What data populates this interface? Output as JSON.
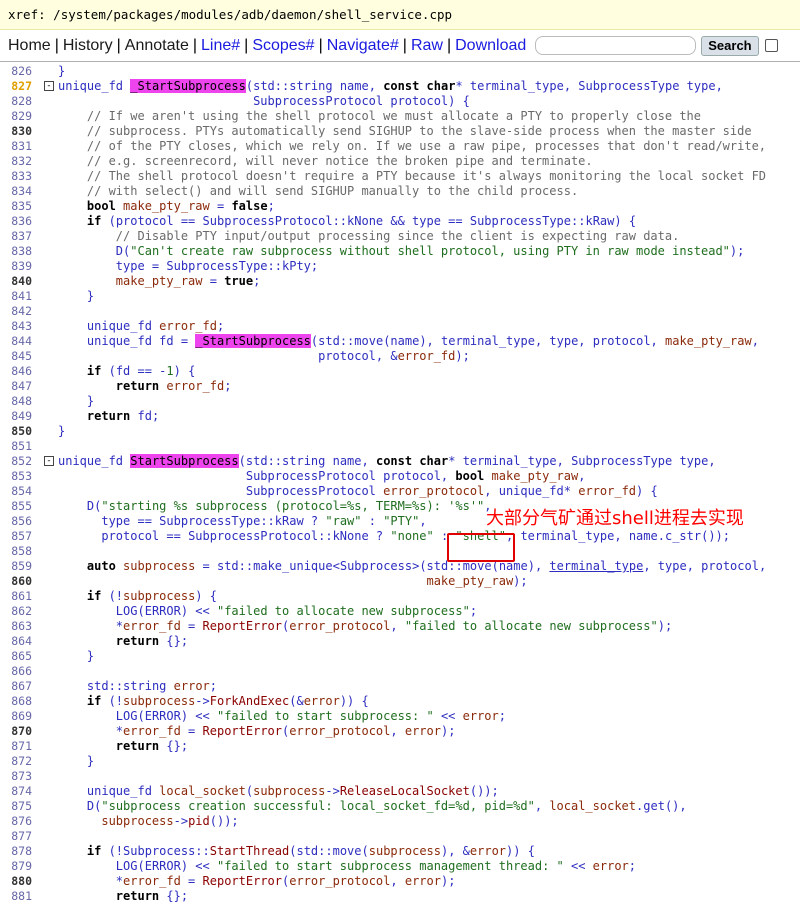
{
  "xref": {
    "label": "xref:",
    "path": "/system/packages/modules/adb/daemon/shell_service.cpp"
  },
  "nav": {
    "items": [
      {
        "label": "Home",
        "strong": true
      },
      {
        "label": "History",
        "strong": true
      },
      {
        "label": "Annotate",
        "strong": true
      },
      {
        "label": "Line#",
        "strong": false
      },
      {
        "label": "Scopes#",
        "strong": false
      },
      {
        "label": "Navigate#",
        "strong": false
      },
      {
        "label": "Raw",
        "strong": false
      },
      {
        "label": "Download",
        "strong": false
      }
    ],
    "search_value": "",
    "search_button": "Search"
  },
  "annotation": {
    "text": "大部分气矿通过shell进程去实现",
    "color": "#ff0000"
  },
  "lines": [
    {
      "n": "826",
      "t": "}"
    },
    {
      "n": "827",
      "t": "unique_fd _StartSubprocess(std::string name, const char* terminal_type, SubprocessType type,",
      "fold": true
    },
    {
      "n": "828",
      "t": "                           SubprocessProtocol protocol) {"
    },
    {
      "n": "829",
      "t": "    // If we aren't using the shell protocol we must allocate a PTY to properly close the"
    },
    {
      "n": "830",
      "t": "    // subprocess. PTYs automatically send SIGHUP to the slave-side process when the master side"
    },
    {
      "n": "831",
      "t": "    // of the PTY closes, which we rely on. If we use a raw pipe, processes that don't read/write,"
    },
    {
      "n": "832",
      "t": "    // e.g. screenrecord, will never notice the broken pipe and terminate."
    },
    {
      "n": "833",
      "t": "    // The shell protocol doesn't require a PTY because it's always monitoring the local socket FD"
    },
    {
      "n": "834",
      "t": "    // with select() and will send SIGHUP manually to the child process."
    },
    {
      "n": "835",
      "t": "    bool make_pty_raw = false;"
    },
    {
      "n": "836",
      "t": "    if (protocol == SubprocessProtocol::kNone && type == SubprocessType::kRaw) {"
    },
    {
      "n": "837",
      "t": "        // Disable PTY input/output processing since the client is expecting raw data."
    },
    {
      "n": "838",
      "t": "        D(\"Can't create raw subprocess without shell protocol, using PTY in raw mode instead\");"
    },
    {
      "n": "839",
      "t": "        type = SubprocessType::kPty;"
    },
    {
      "n": "840",
      "t": "        make_pty_raw = true;"
    },
    {
      "n": "841",
      "t": "    }"
    },
    {
      "n": "842",
      "t": ""
    },
    {
      "n": "843",
      "t": "    unique_fd error_fd;"
    },
    {
      "n": "844",
      "t": "    unique_fd fd = _StartSubprocess(std::move(name), terminal_type, type, protocol, make_pty_raw,"
    },
    {
      "n": "845",
      "t": "                                    protocol, &error_fd);"
    },
    {
      "n": "846",
      "t": "    if (fd == -1) {"
    },
    {
      "n": "847",
      "t": "        return error_fd;"
    },
    {
      "n": "848",
      "t": "    }"
    },
    {
      "n": "849",
      "t": "    return fd;"
    },
    {
      "n": "850",
      "t": "}"
    },
    {
      "n": "851",
      "t": ""
    },
    {
      "n": "852",
      "t": "unique_fd StartSubprocess(std::string name, const char* terminal_type, SubprocessType type,",
      "fold": true
    },
    {
      "n": "853",
      "t": "                          SubprocessProtocol protocol, bool make_pty_raw,"
    },
    {
      "n": "854",
      "t": "                          SubprocessProtocol error_protocol, unique_fd* error_fd) {"
    },
    {
      "n": "855",
      "t": "    D(\"starting %s subprocess (protocol=%s, TERM=%s): '%s'\","
    },
    {
      "n": "856",
      "t": "      type == SubprocessType::kRaw ? \"raw\" : \"PTY\","
    },
    {
      "n": "857",
      "t": "      protocol == SubprocessProtocol::kNone ? \"none\" : \"shell\", terminal_type, name.c_str());"
    },
    {
      "n": "858",
      "t": ""
    },
    {
      "n": "859",
      "t": "    auto subprocess = std::make_unique<Subprocess>(std::move(name), terminal_type, type, protocol,"
    },
    {
      "n": "860",
      "t": "                                                   make_pty_raw);"
    },
    {
      "n": "861",
      "t": "    if (!subprocess) {"
    },
    {
      "n": "862",
      "t": "        LOG(ERROR) << \"failed to allocate new subprocess\";"
    },
    {
      "n": "863",
      "t": "        *error_fd = ReportError(error_protocol, \"failed to allocate new subprocess\");"
    },
    {
      "n": "864",
      "t": "        return {};"
    },
    {
      "n": "865",
      "t": "    }"
    },
    {
      "n": "866",
      "t": ""
    },
    {
      "n": "867",
      "t": "    std::string error;"
    },
    {
      "n": "868",
      "t": "    if (!subprocess->ForkAndExec(&error)) {"
    },
    {
      "n": "869",
      "t": "        LOG(ERROR) << \"failed to start subprocess: \" << error;"
    },
    {
      "n": "870",
      "t": "        *error_fd = ReportError(error_protocol, error);"
    },
    {
      "n": "871",
      "t": "        return {};"
    },
    {
      "n": "872",
      "t": "    }"
    },
    {
      "n": "873",
      "t": ""
    },
    {
      "n": "874",
      "t": "    unique_fd local_socket(subprocess->ReleaseLocalSocket());"
    },
    {
      "n": "875",
      "t": "    D(\"subprocess creation successful: local_socket_fd=%d, pid=%d\", local_socket.get(),"
    },
    {
      "n": "876",
      "t": "      subprocess->pid());"
    },
    {
      "n": "877",
      "t": ""
    },
    {
      "n": "878",
      "t": "    if (!Subprocess::StartThread(std::move(subprocess), &error)) {"
    },
    {
      "n": "879",
      "t": "        LOG(ERROR) << \"failed to start subprocess management thread: \" << error;"
    },
    {
      "n": "880",
      "t": "        *error_fd = ReportError(error_protocol, error);"
    },
    {
      "n": "881",
      "t": "        return {};"
    }
  ]
}
